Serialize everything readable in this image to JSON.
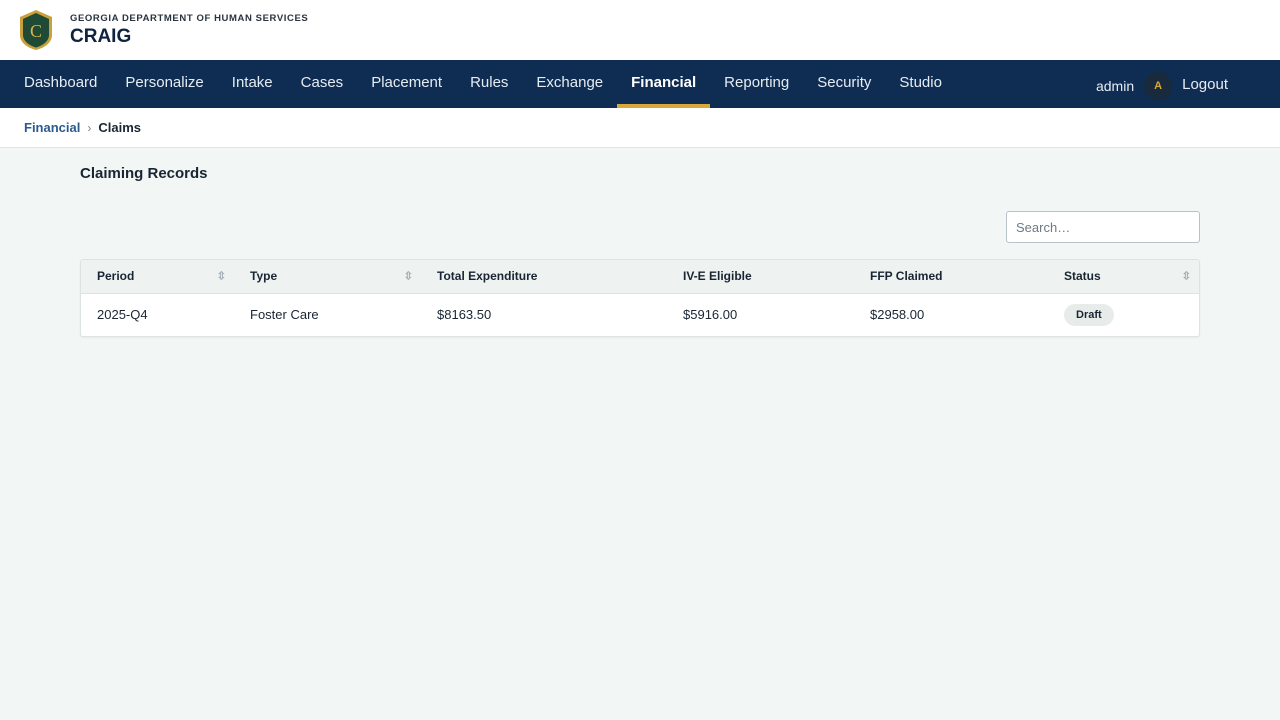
{
  "header": {
    "department": "GEORGIA DEPARTMENT OF HUMAN SERVICES",
    "app_name": "CRAIG",
    "logo_letter": "C"
  },
  "nav": {
    "items": [
      {
        "label": "Dashboard"
      },
      {
        "label": "Personalize"
      },
      {
        "label": "Intake"
      },
      {
        "label": "Cases"
      },
      {
        "label": "Placement"
      },
      {
        "label": "Rules"
      },
      {
        "label": "Exchange"
      },
      {
        "label": "Financial",
        "active": true
      },
      {
        "label": "Reporting"
      },
      {
        "label": "Security"
      },
      {
        "label": "Studio"
      }
    ],
    "user": "admin",
    "avatar_letter": "A",
    "logout_label": "Logout"
  },
  "breadcrumb": {
    "parent": "Financial",
    "separator": "›",
    "current": "Claims"
  },
  "main": {
    "title": "Claiming Records",
    "search_placeholder": "Search…"
  },
  "table": {
    "columns": [
      {
        "label": "Period",
        "sortable": true
      },
      {
        "label": "Type",
        "sortable": true
      },
      {
        "label": "Total Expenditure",
        "sortable": false
      },
      {
        "label": "IV-E Eligible",
        "sortable": false
      },
      {
        "label": "FFP Claimed",
        "sortable": false
      },
      {
        "label": "Status",
        "sortable": true
      }
    ],
    "sort_glyph": "⇳",
    "rows": [
      {
        "period": "2025-Q4",
        "type": "Foster Care",
        "total_expenditure": "$8163.50",
        "ive_eligible": "$5916.00",
        "ffp_claimed": "$2958.00",
        "status": "Draft"
      }
    ]
  },
  "colors": {
    "nav_bg": "#0f2d52",
    "nav_active_underline": "#d8a93a",
    "page_bg": "#f2f6f4",
    "logo_green": "#1f4a35",
    "logo_gold": "#c9a13c"
  },
  "icons": {
    "logo": "shield-logo-icon",
    "sort": "sort-icon"
  }
}
